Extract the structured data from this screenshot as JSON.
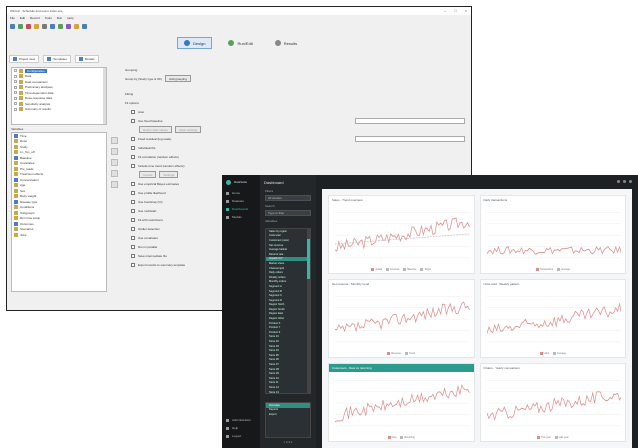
{
  "colors": {
    "accent": "#37b7a6",
    "accent_dark": "#2c9b8d",
    "app_bg": "#1e2123",
    "series_main": "#e08a8a",
    "series_alt": "#b9b9b9",
    "selection_blue": "#3a78c7"
  },
  "back_window": {
    "title": "WinCal - Schedule and event index.exe",
    "menu": [
      "File",
      "Edit",
      "Record",
      "Tools",
      "Run",
      "Help"
    ],
    "window_controls": [
      "–",
      "□",
      "×"
    ],
    "top_tabs": [
      {
        "label": "Design",
        "icon": "design-icon"
      },
      {
        "label": "Run/Edit",
        "icon": "run-icon"
      },
      {
        "label": "Results",
        "icon": "results-icon"
      }
    ],
    "left_tabs": [
      "Project view",
      "Templates",
      "Models"
    ],
    "tree_top": [
      "Configuration",
      "Data",
      "Data comparison",
      "Preliminary analyses",
      "Time-dependent data",
      "Dose-response data",
      "Sensitivity analysis",
      "Summary of results"
    ],
    "filter_label": "Variables",
    "tree_bottom": [
      "Time",
      "Dose",
      "Study",
      "Ln_Tox_eff",
      "Baseline",
      "Covariates",
      "Pre_loads",
      "Treatment effects",
      "Concentration",
      "Age",
      "Sex",
      "Body weight",
      "Disease type",
      "Conditions",
      "Subgroups",
      "Run time setup",
      "Outcomes",
      "Scenarios",
      "Jobs"
    ],
    "form": {
      "section1": "Grouping",
      "group_by_label": "Group by (Study type & Ob)",
      "group_by_button": "Add grouping",
      "section2": "Fitting",
      "options_label": "Fit options",
      "rows": [
        "Auto",
        "Use fixed baseline",
        "Fixed residual (log scale)",
        "Individual fits",
        "Fit correlation (random effects)",
        "Include time trend (random effects)",
        "Use empirical Bayes estimates",
        "Use profile likelihood",
        "Use bootstrap (CI)",
        "Use multistart",
        "Fit with restrictions",
        "Outlier detection",
        "Use covariates",
        "Run in parallel",
        "Save intermediate fits",
        "Export results to summary template"
      ],
      "sub_buttons": [
        "Define start values",
        "Clear settings",
        "Cancel",
        "Settings"
      ]
    }
  },
  "front_app": {
    "rail_logo": "DataSuite",
    "rail_items": [
      "Home",
      "Datasets",
      "Dashboards",
      "Models"
    ],
    "rail_bottom_items": [
      "Administration",
      "Help",
      "Logout"
    ],
    "panel_title": "Dashboard",
    "panel_labels": [
      "Filters",
      "Search",
      "Variables"
    ],
    "panel_field_values": [
      "All studies",
      "Type to filter"
    ],
    "list_items": [
      "Sales by region",
      "Units total",
      "Customers (new)",
      "Net revenue",
      "Average basket",
      "Returns rate",
      "Growth YoY",
      "Market share",
      "Channel split",
      "Daily orders",
      "Weekly orders",
      "Monthly orders",
      "Segment A",
      "Segment B",
      "Segment C",
      "Segment D",
      "Region North",
      "Region South",
      "Region East",
      "Region West",
      "Product X",
      "Product Y",
      "Product Z",
      "Store 01",
      "Store 02",
      "Store 03",
      "Store 04",
      "Store 05",
      "Store 06",
      "Store 07",
      "Store 08",
      "Store 09",
      "Store 10",
      "Store 11",
      "Store 12",
      "Store 13"
    ],
    "highlighted_index": 6,
    "bottom_list": [
      "Overview",
      "Reports",
      "Export"
    ],
    "panel_tail": "v 2.4.1",
    "cards": [
      {
        "title": "Sales - Trend overview",
        "legend": [
          "Actual",
          "Forecast",
          "Baseline",
          "Target"
        ],
        "teal": false
      },
      {
        "title": "Daily transactions",
        "legend": [
          "Transactions",
          "Average"
        ],
        "teal": false
      },
      {
        "title": "Net revenue - Monthly trend",
        "legend": [
          "Revenue",
          "Trend"
        ],
        "teal": false
      },
      {
        "title": "Units sold - Weekly pattern",
        "legend": [
          "Units",
          "Average"
        ],
        "teal": false
      },
      {
        "title": "Customers - New vs returning",
        "legend": [
          "New",
          "Returning"
        ],
        "teal": true
      },
      {
        "title": "Orders - Yearly comparison",
        "legend": [
          "This year",
          "Last year"
        ],
        "teal": false
      }
    ]
  }
}
